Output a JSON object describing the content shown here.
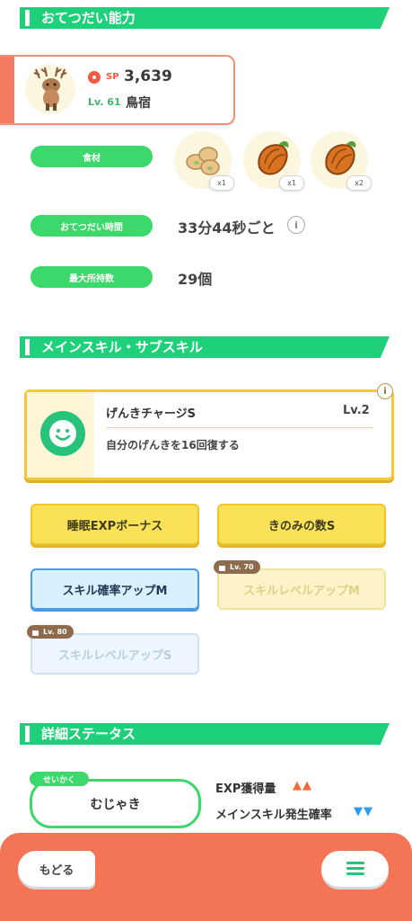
{
  "helping_section": {
    "title": "おてつだい能力"
  },
  "pokemon": {
    "sp_label": "SP",
    "sp_value": "3,639",
    "level": "Lv. 61",
    "name": "鳥宿"
  },
  "ingredients": {
    "label": "食材",
    "items": [
      {
        "icon": "soybeans-icon",
        "qty": "x1"
      },
      {
        "icon": "cacao-icon",
        "qty": "x1"
      },
      {
        "icon": "cacao-icon",
        "qty": "x2"
      }
    ]
  },
  "helping_time": {
    "label": "おてつだい時間",
    "value": "33分44秒ごと"
  },
  "max_carry": {
    "label": "最大所持数",
    "value": "29個"
  },
  "skills_section": {
    "title": "メインスキル・サブスキル"
  },
  "main_skill": {
    "name": "げんきチャージS",
    "level": "Lv.2",
    "description": "自分のげんきを16回復する"
  },
  "sub_skills": [
    {
      "label": "睡眠EXPボーナス"
    },
    {
      "label": "きのみの数S"
    },
    {
      "label": "スキル確率アップM"
    },
    {
      "label": "スキルレベルアップM",
      "lock": "Lv. 70"
    },
    {
      "label": "スキルレベルアップS",
      "lock": "Lv. 80"
    }
  ],
  "detail_section": {
    "title": "詳細ステータス"
  },
  "nature": {
    "tag": "せいかく",
    "value": "むじゃき"
  },
  "nature_effects": [
    {
      "label": "EXP獲得量",
      "marks": "▲▲",
      "color": "#f26b3a"
    },
    {
      "label": "メインスキル発生確率",
      "marks": "▼▼",
      "color": "#2f9bef"
    }
  ],
  "nav": {
    "back_label": "もどる"
  }
}
